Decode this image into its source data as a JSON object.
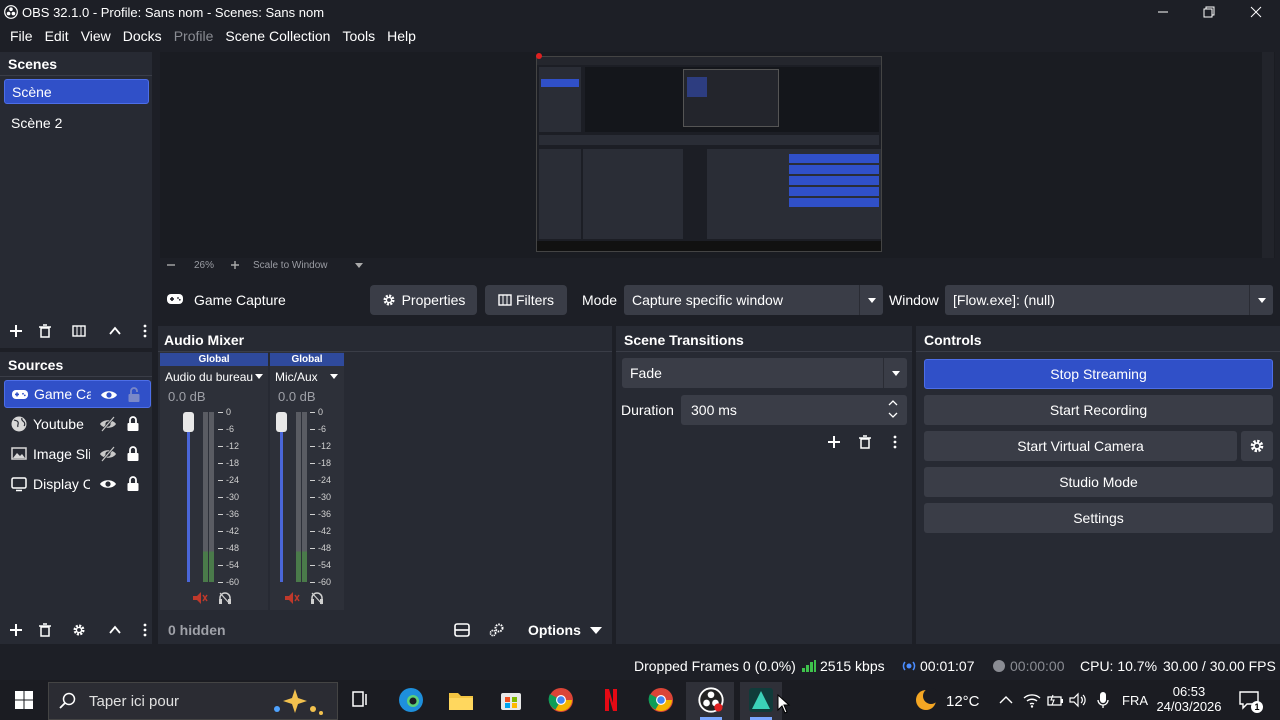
{
  "window": {
    "title": "OBS 32.1.0 - Profile: Sans nom - Scenes: Sans nom"
  },
  "menu": [
    "File",
    "Edit",
    "View",
    "Docks",
    "Profile",
    "Scene Collection",
    "Tools",
    "Help"
  ],
  "scenes": {
    "title": "Scenes",
    "items": [
      "Scène",
      "Scène 2"
    ]
  },
  "sources": {
    "title": "Sources",
    "items": [
      {
        "label": "Game Capture",
        "icon": "gamepad-icon",
        "visible": true,
        "locked": false
      },
      {
        "label": "Youtube",
        "icon": "globe-icon",
        "visible": false,
        "locked": true
      },
      {
        "label": "Image Slideshow",
        "icon": "slideshow-icon",
        "visible": false,
        "locked": true
      },
      {
        "label": "Display Capture",
        "icon": "monitor-icon",
        "visible": true,
        "locked": true
      }
    ]
  },
  "preview": {
    "zoom": "26%",
    "scale_mode": "Scale to Window"
  },
  "properties_bar": {
    "source_name": "Game Capture",
    "properties_label": "Properties",
    "filters_label": "Filters",
    "mode_label": "Mode",
    "mode_value": "Capture specific window",
    "window_label": "Window",
    "window_value": "[Flow.exe]: (null)"
  },
  "audio_mixer": {
    "title": "Audio Mixer",
    "channels": [
      {
        "tag": "Global",
        "name": "Audio du bureau",
        "db": "0.0 dB",
        "level": 1.0
      },
      {
        "tag": "Global",
        "name": "Mic/Aux",
        "db": "0.0 dB",
        "level": 1.0
      }
    ],
    "scale": [
      "0",
      "-6",
      "-12",
      "-18",
      "-24",
      "-30",
      "-36",
      "-42",
      "-48",
      "-54",
      "-60"
    ],
    "hidden_label": "0 hidden",
    "options_label": "Options"
  },
  "scene_transitions": {
    "title": "Scene Transitions",
    "transition": "Fade",
    "duration_label": "Duration",
    "duration_value": "300 ms"
  },
  "controls": {
    "title": "Controls",
    "stop_streaming": "Stop Streaming",
    "start_recording": "Start Recording",
    "start_virtual_camera": "Start Virtual Camera",
    "studio_mode": "Studio Mode",
    "settings": "Settings"
  },
  "status": {
    "dropped_frames": "Dropped Frames 0 (0.0%)",
    "bitrate": "2515 kbps",
    "stream_time": "00:01:07",
    "record_time": "00:00:00",
    "cpu": "CPU: 10.7%",
    "fps": "30.00 / 30.00 FPS"
  },
  "taskbar": {
    "search_placeholder": "Taper ici pour",
    "weather": "12°C",
    "language": "FRA",
    "time": "06:53",
    "date": "24/03/2026",
    "notification_count": "1"
  },
  "colors": {
    "accent": "#3050c8",
    "panel": "#272a33",
    "background": "#1d1f26"
  }
}
